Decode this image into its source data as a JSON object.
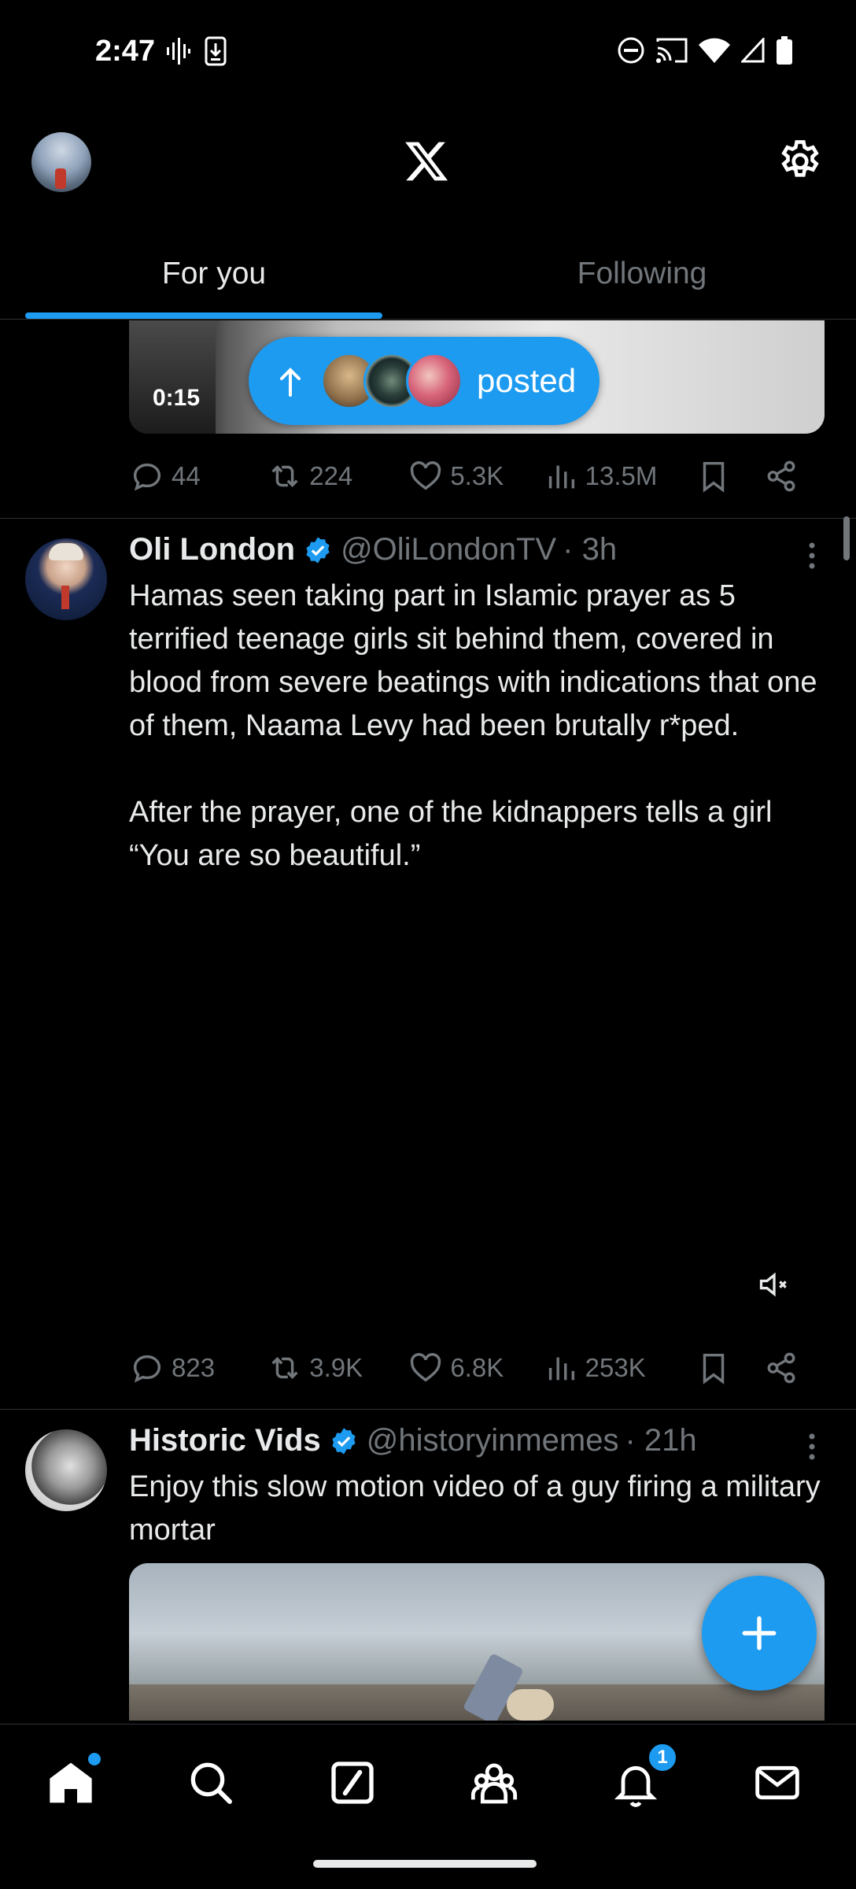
{
  "status_bar": {
    "time": "2:47"
  },
  "header": {
    "logo": "x-logo",
    "settings_icon": "gear-icon"
  },
  "tabs": [
    {
      "label": "For you",
      "active": true
    },
    {
      "label": "Following",
      "active": false
    }
  ],
  "posted_pill": {
    "label": "posted"
  },
  "previous_tweet": {
    "video_duration": "0:15",
    "stats": {
      "replies": "44",
      "reposts": "224",
      "likes": "5.3K",
      "views": "13.5M"
    }
  },
  "tweets": [
    {
      "name": "Oli London",
      "handle": "@OliLondonTV",
      "time": "· 3h",
      "verified": true,
      "text": "Hamas seen taking part in Islamic prayer as 5 terrified teenage girls sit behind them, covered in blood from severe beatings with indications that one of them, Naama Levy had been brutally r*ped.\n\nAfter the prayer, one of the kidnappers tells a girl “You are so beautiful.”",
      "stats": {
        "replies": "823",
        "reposts": "3.9K",
        "likes": "6.8K",
        "views": "253K"
      }
    },
    {
      "name": "Historic Vids",
      "handle": "@historyinmemes",
      "time": "· 21h",
      "verified": true,
      "text": "Enjoy this slow motion video of a guy firing a military mortar"
    }
  ],
  "bottom_nav": {
    "items": [
      "home-icon",
      "search-icon",
      "grok-icon",
      "communities-icon",
      "notifications-icon",
      "messages-icon"
    ],
    "notifications_badge": "1"
  },
  "colors": {
    "accent": "#1d9bf0",
    "background": "#000000",
    "muted": "#71767b",
    "text": "#e7e9ea"
  }
}
